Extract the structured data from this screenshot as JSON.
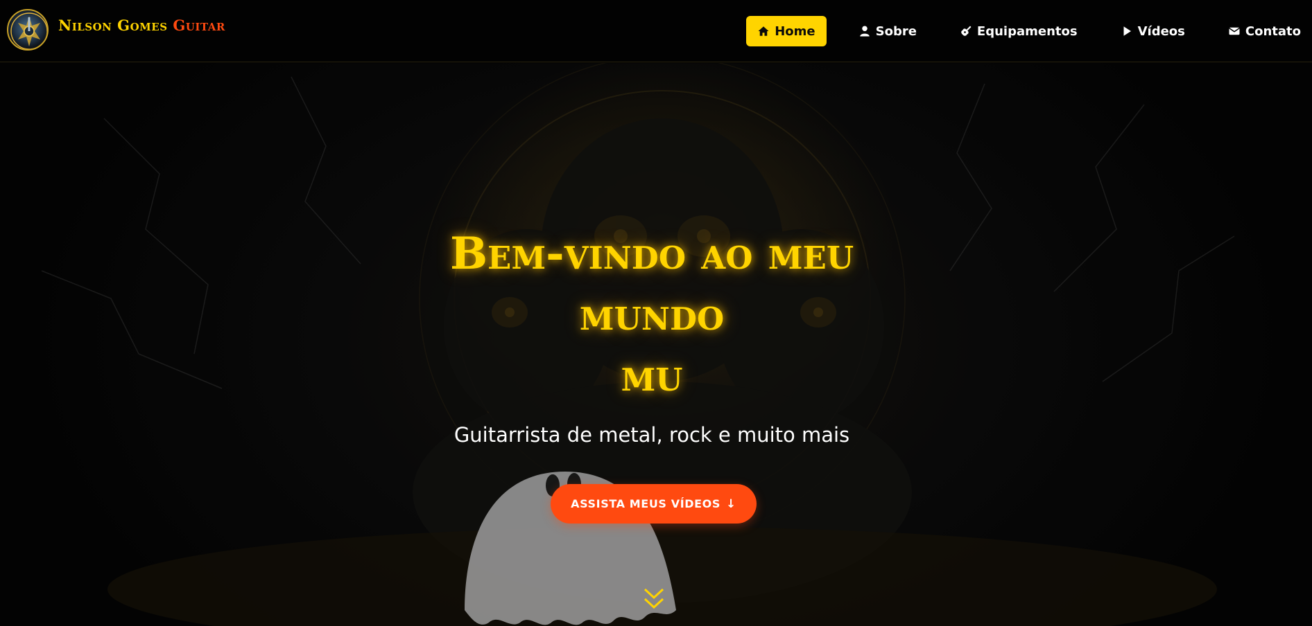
{
  "brand": {
    "name_part1": "Nilson Gomes",
    "name_part2": "Guitar",
    "logo_icon": "guitar-emblem-logo",
    "colors": {
      "yellow": "#ffd400",
      "orange": "#ff4a10"
    }
  },
  "nav": {
    "items": [
      {
        "label": "Home",
        "icon": "home-icon",
        "active": true
      },
      {
        "label": "Sobre",
        "icon": "user-icon",
        "active": false
      },
      {
        "label": "Equipamentos",
        "icon": "guitar-icon",
        "active": false
      },
      {
        "label": "Vídeos",
        "icon": "play-icon",
        "active": false
      },
      {
        "label": "Contato",
        "icon": "envelope-icon",
        "active": false
      }
    ]
  },
  "hero": {
    "title_line1": "Bem-vindo ao meu mundo",
    "title_line2": "mu",
    "subtitle": "Guitarrista de metal, rock e muito mais",
    "cta_label": "ASSISTA MEUS VÍDEOS",
    "cta_arrow": "↓",
    "scroll_icon": "double-chevron-down-icon",
    "background_image": "dark skulls with lightning and ghost illustration"
  }
}
